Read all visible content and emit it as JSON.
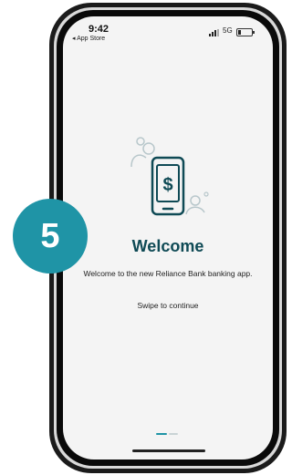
{
  "status_bar": {
    "time": "9:42",
    "back_label": "◂ App Store",
    "network": "5G",
    "battery_level": 0.2
  },
  "onboarding": {
    "title": "Welcome",
    "subtitle": "Welcome to the new Reliance Bank banking app.",
    "hint": "Swipe to continue",
    "pages": 2,
    "active_page": 1
  },
  "overlay": {
    "step_number": "5"
  },
  "colors": {
    "accent": "#1f94a6",
    "title": "#0f4a55",
    "screen_bg": "#f4f4f4"
  }
}
